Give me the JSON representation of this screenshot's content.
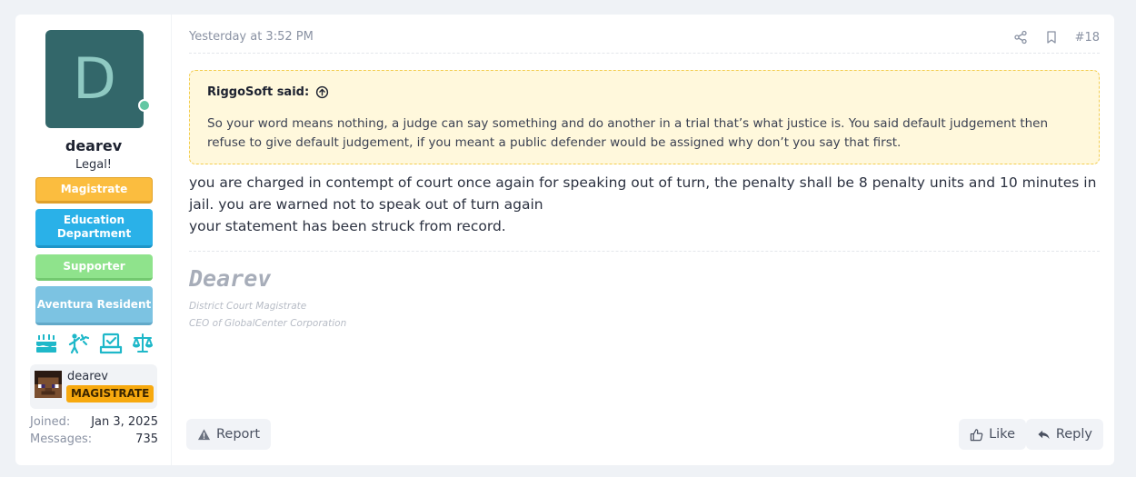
{
  "post": {
    "date": "Yesterday at 3:52 PM",
    "number": "#18"
  },
  "user": {
    "avatar_letter": "D",
    "avatar_bg": "#33676a",
    "username": "dearev",
    "title": "Legal!",
    "banners": [
      {
        "label": "Magistrate",
        "color": "#fbbd3f"
      },
      {
        "label": "Education Department",
        "color": "#2ab1e8"
      },
      {
        "label": "Supporter",
        "color": "#8fe38c"
      },
      {
        "label": "Aventura Resident",
        "color": "#7cc3e2"
      }
    ],
    "trophy_icons": [
      "cake-icon",
      "celebrate-icon",
      "ballot-icon",
      "scales-icon"
    ],
    "minecraft": {
      "name": "dearev",
      "rank": "MAGISTRATE",
      "rank_color": "#f7a90e"
    },
    "stats": [
      {
        "label": "Joined:",
        "value": "Jan 3, 2025"
      },
      {
        "label": "Messages:",
        "value": "735"
      }
    ]
  },
  "quote": {
    "author": "RiggoSoft said:",
    "text": "So your word means nothing, a judge can say something and do another in a trial that’s what justice is. You said default judgement then refuse to give default judgement, if you meant a public defender would be assigned why don’t you say that first."
  },
  "message": {
    "line1": "you are charged in contempt of court once again for speaking out of turn, the penalty shall be 8 penalty units and 10 minutes in jail. you are warned not to speak out of turn again",
    "line2": "your statement has been struck from record."
  },
  "signature": {
    "name": "Dearev",
    "line1": "District Court Magistrate",
    "line2": "CEO of GlobalCenter Corporation"
  },
  "actions": {
    "report": "Report",
    "like": "Like",
    "reply": "Reply"
  }
}
